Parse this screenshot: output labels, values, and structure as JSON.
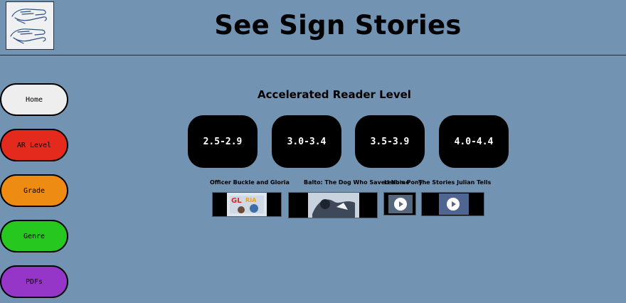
{
  "site": {
    "title": "See Sign Stories",
    "logo_icon": "signing-hands-icon"
  },
  "nav": {
    "items": [
      {
        "label": "Home",
        "color": "#eeeeee"
      },
      {
        "label": "AR Level",
        "color": "#e42a1c"
      },
      {
        "label": "Grade",
        "color": "#ee8b12"
      },
      {
        "label": "Genre",
        "color": "#26c81f"
      },
      {
        "label": "PDFs",
        "color": "#9636c9"
      }
    ]
  },
  "main": {
    "heading": "Accelerated Reader Level",
    "levels": [
      "2.5-2.9",
      "3.0-3.4",
      "3.5-3.9",
      "4.0-4.4"
    ],
    "stories": [
      {
        "title": "Officer Buckle and Gloria",
        "thumb_icon": "book-cover-video-thumbnail"
      },
      {
        "title": "Balto: The Dog Who Saved Nome",
        "thumb_icon": "book-cover-video-thumbnail"
      },
      {
        "title": "Leah's Pony",
        "thumb_icon": "play-icon"
      },
      {
        "title": "The Stories Julian Tells",
        "thumb_icon": "play-icon"
      }
    ]
  }
}
